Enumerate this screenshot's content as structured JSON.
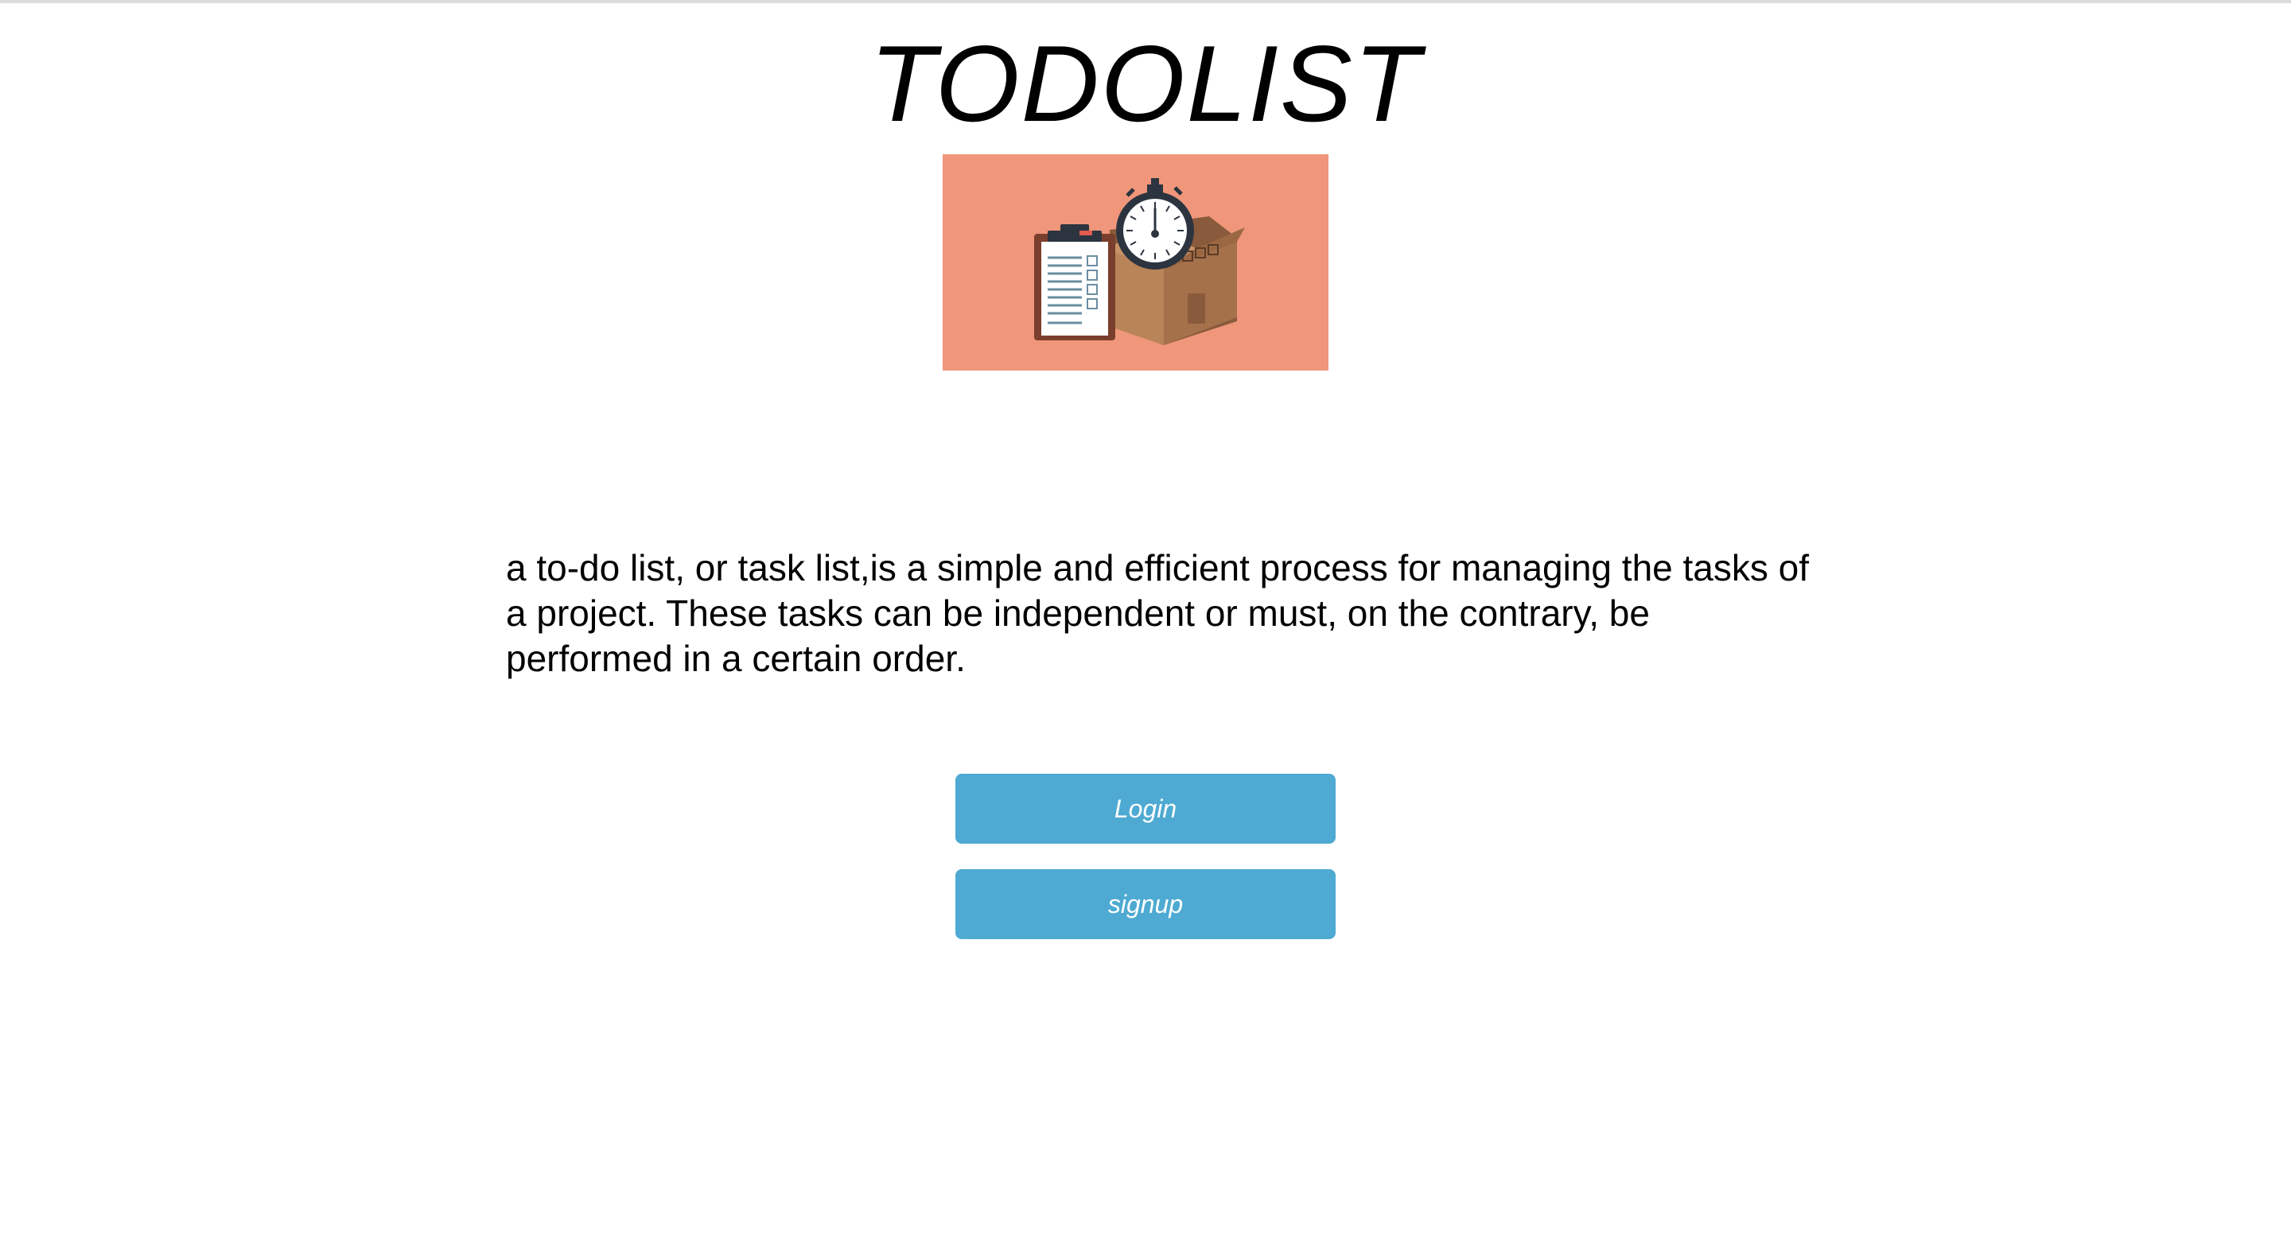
{
  "header": {
    "title": "TODOLIST"
  },
  "hero": {
    "image": "clipboard-box-stopwatch-illustration",
    "background_color": "#f0967a"
  },
  "main": {
    "description": "a to-do list, or task list,is a simple and efficient process for managing the tasks of a project. These tasks can be independent or must, on the contrary, be performed in a certain order."
  },
  "actions": {
    "login_label": "Login",
    "signup_label": "signup",
    "button_color": "#4eaad2"
  }
}
